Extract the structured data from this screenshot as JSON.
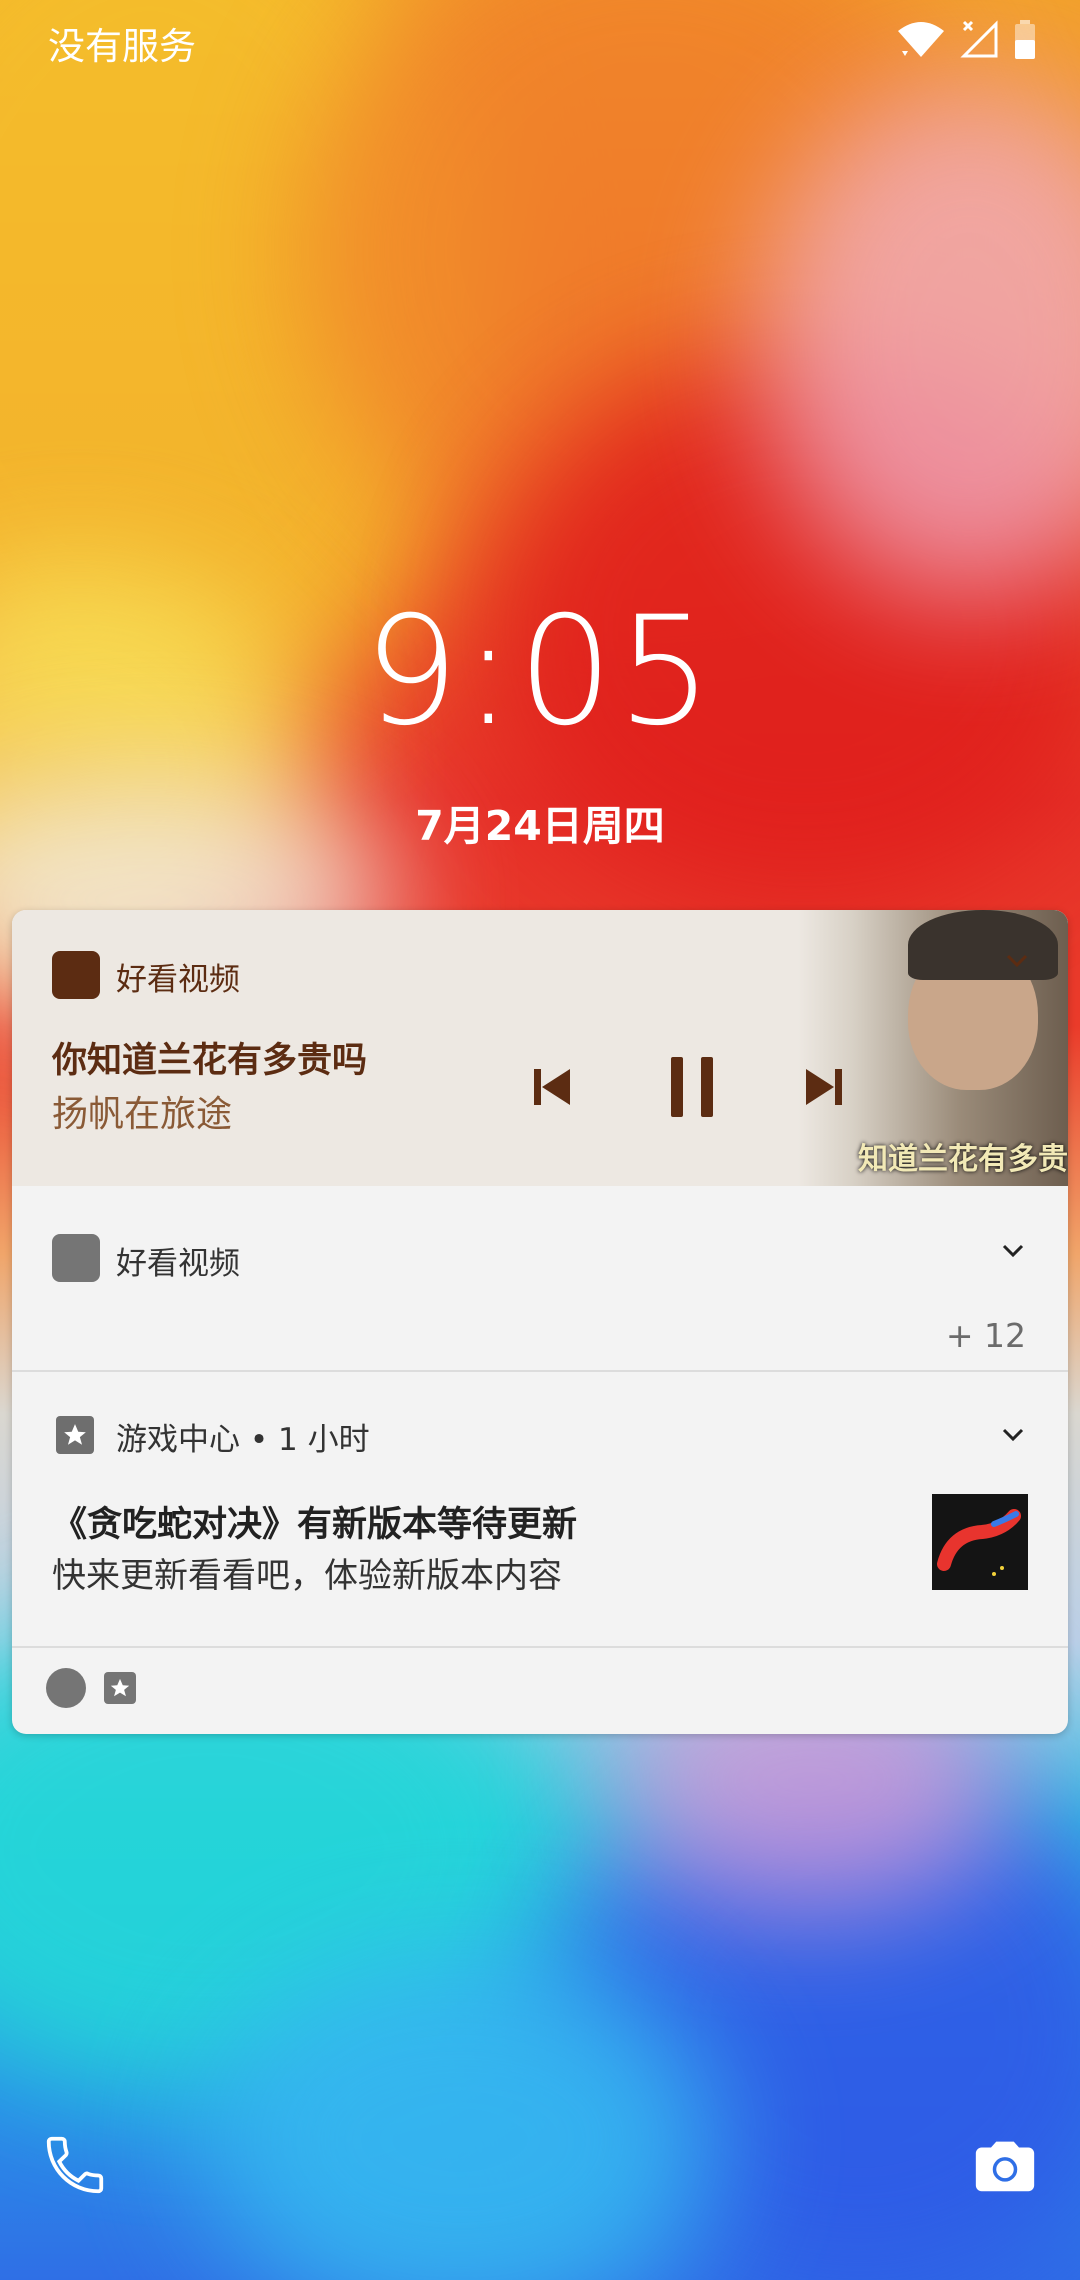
{
  "status_bar": {
    "carrier": "没有服务",
    "icons": [
      "wifi-icon",
      "no-signal-icon",
      "battery-icon"
    ]
  },
  "lockscreen": {
    "time": "9:05",
    "date": "7月24日周四"
  },
  "notifications": {
    "media": {
      "app_name": "好看视频",
      "title": "你知道兰花有多贵吗",
      "artist": "扬帆在旅途",
      "art_caption": "知道兰花有多贵",
      "controls": [
        "previous-icon",
        "pause-icon",
        "next-icon"
      ],
      "accent_color": "#5c2c12"
    },
    "group": {
      "app_name": "好看视频",
      "more_count": "+ 12"
    },
    "game": {
      "header": "游戏中心 • 1 小时",
      "title": "《贪吃蛇对决》有新版本等待更新",
      "body": "快来更新看看吧，体验新版本内容"
    }
  },
  "shortcuts": [
    "phone-icon",
    "camera-icon"
  ]
}
